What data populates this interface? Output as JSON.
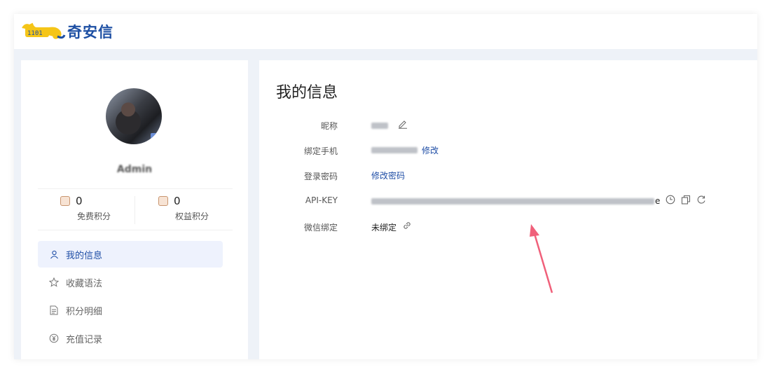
{
  "brand": {
    "name": "奇安信"
  },
  "user": {
    "nickname": "Admin"
  },
  "stats": [
    {
      "value": "0",
      "label": "免费积分",
      "icon": "coin-icon"
    },
    {
      "value": "0",
      "label": "权益积分",
      "icon": "gift-icon"
    }
  ],
  "menu": [
    {
      "label": "我的信息",
      "icon": "user-icon",
      "active": true
    },
    {
      "label": "收藏语法",
      "icon": "star-icon",
      "active": false
    },
    {
      "label": "积分明细",
      "icon": "document-icon",
      "active": false
    },
    {
      "label": "充值记录",
      "icon": "yen-circle-icon",
      "active": false
    }
  ],
  "profile": {
    "title": "我的信息",
    "nickname_label": "昵称",
    "phone_label": "绑定手机",
    "phone_edit": "修改",
    "password_label": "登录密码",
    "password_link": "修改密码",
    "apikey_label": "API-KEY",
    "apikey_tail": "e",
    "wechat_label": "微信绑定",
    "wechat_value": "未绑定"
  },
  "colors": {
    "accent": "#1f4ea6",
    "arrow": "#f0607a"
  }
}
